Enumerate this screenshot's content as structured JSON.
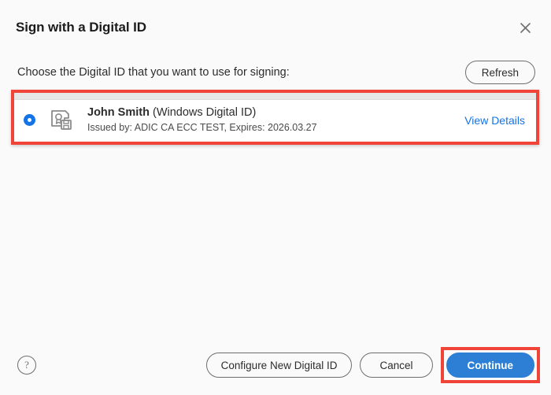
{
  "dialog": {
    "title": "Sign with a Digital ID",
    "close_icon": "close-icon"
  },
  "prompt": {
    "text": "Choose the Digital ID that you want to use for signing:",
    "refresh_label": "Refresh"
  },
  "id_list": {
    "items": [
      {
        "selected": true,
        "icon": "digital-id-certificate-icon",
        "name": "John Smith",
        "kind": "(Windows Digital ID)",
        "details": "Issued by: ADIC CA ECC TEST, Expires: 2026.03.27",
        "view_details_label": "View Details"
      }
    ]
  },
  "footer": {
    "help_icon_label": "?",
    "configure_label": "Configure New Digital ID",
    "cancel_label": "Cancel",
    "continue_label": "Continue"
  },
  "colors": {
    "accent_blue": "#1473e6",
    "continue_blue": "#2c7fd4",
    "highlight_red": "#f04438",
    "background": "#fafafa",
    "list_background": "#ffffff",
    "text": "#2c2c2c",
    "muted": "#6e6e6e"
  }
}
